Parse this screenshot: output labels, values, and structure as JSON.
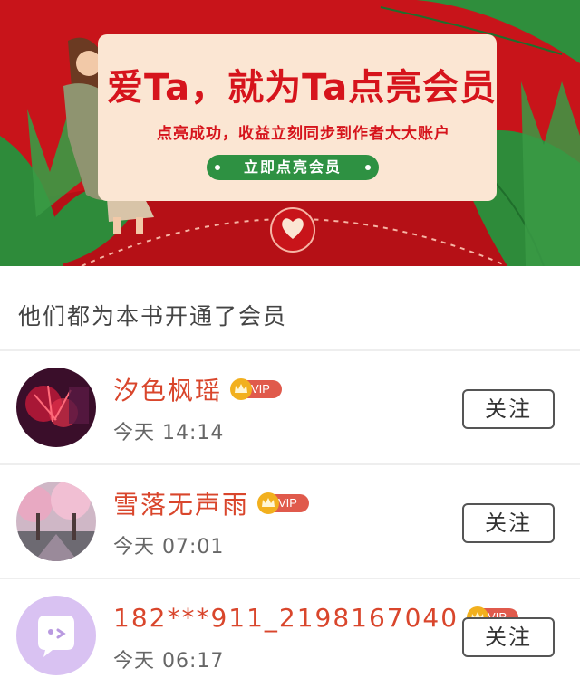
{
  "banner": {
    "title": "爱Ta，就为Ta点亮会员",
    "subtitle": "点亮成功，收益立刻同步到作者大大账户",
    "button_label": "立即点亮会员",
    "colors": {
      "background": "#c8141a",
      "card": "#fbe6d3",
      "title": "#d6141c",
      "button": "#2e9142",
      "leaf": "#2e8b3a"
    },
    "icons": [
      "heart-seal-icon",
      "woman-reading-illustration",
      "leaf-decoration"
    ]
  },
  "section": {
    "title": "他们都为本书开通了会员"
  },
  "members": [
    {
      "name": "汐色枫瑶",
      "badge": "VIP",
      "time": "今天 14:14",
      "follow_label": "关注",
      "avatar": "red-spider-lily-avatar"
    },
    {
      "name": "雪落无声雨",
      "badge": "VIP",
      "time": "今天 07:01",
      "follow_label": "关注",
      "avatar": "cherry-blossom-avatar"
    },
    {
      "name": "182***911_2198167040",
      "badge": "VIP",
      "time": "今天 06:17",
      "follow_label": "关注",
      "avatar": "default-chat-bubble-avatar"
    }
  ],
  "colors": {
    "name": "#d9462c",
    "vip_badge": "#e05a4c",
    "crown": "#f2b01e",
    "avatar_default": "#d9c2f2"
  }
}
